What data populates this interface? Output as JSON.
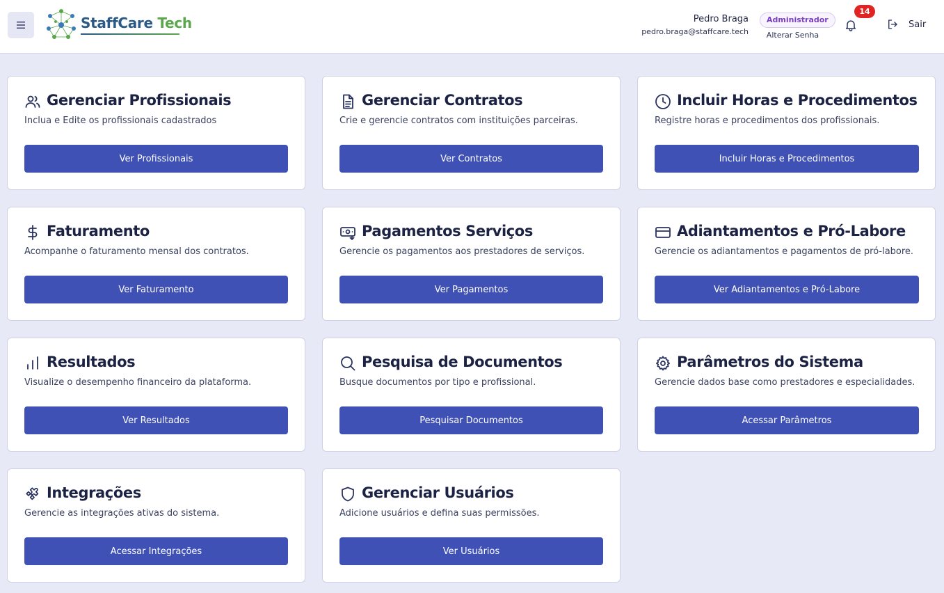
{
  "header": {
    "brand_part1": "StaffCare",
    "brand_part2": " Tech",
    "user_name": "Pedro Braga",
    "user_email": "pedro.braga@staffcare.tech",
    "role": "Administrador",
    "change_password": "Alterar Senha",
    "notification_count": "14",
    "logout_label": "Sair"
  },
  "cards": [
    {
      "icon": "users-icon",
      "title": "Gerenciar Profissionais",
      "description": "Inclua e Edite os profissionais cadastrados",
      "button": "Ver Profissionais"
    },
    {
      "icon": "document-icon",
      "title": "Gerenciar Contratos",
      "description": "Crie e gerencie contratos com instituições parceiras.",
      "button": "Ver Contratos"
    },
    {
      "icon": "clock-icon",
      "title": "Incluir Horas e Procedimentos",
      "description": "Registre horas e procedimentos dos profissionais.",
      "button": "Incluir Horas e Procedimentos"
    },
    {
      "icon": "dollar-icon",
      "title": "Faturamento",
      "description": "Acompanhe o faturamento mensal dos contratos.",
      "button": "Ver Faturamento"
    },
    {
      "icon": "payment-icon",
      "title": "Pagamentos Serviços",
      "description": "Gerencie os pagamentos aos prestadores de serviços.",
      "button": "Ver Pagamentos"
    },
    {
      "icon": "credit-card-icon",
      "title": "Adiantamentos e Pró-Labore",
      "description": "Gerencie os adiantamentos e pagamentos de pró-labore.",
      "button": "Ver Adiantamentos e Pró-Labore"
    },
    {
      "icon": "bar-chart-icon",
      "title": "Resultados",
      "description": "Visualize o desempenho financeiro da plataforma.",
      "button": "Ver Resultados"
    },
    {
      "icon": "search-icon",
      "title": "Pesquisa de Documentos",
      "description": "Busque documentos por tipo e profissional.",
      "button": "Pesquisar Documentos"
    },
    {
      "icon": "gear-icon",
      "title": "Parâmetros do Sistema",
      "description": "Gerencie dados base como prestadores e especialidades.",
      "button": "Acessar Parâmetros"
    },
    {
      "icon": "puzzle-icon",
      "title": "Integrações",
      "description": "Gerencie as integrações ativas do sistema.",
      "button": "Acessar Integrações"
    },
    {
      "icon": "shield-icon",
      "title": "Gerenciar Usuários",
      "description": "Adicione usuários e defina suas permissões.",
      "button": "Ver Usuários"
    }
  ]
}
